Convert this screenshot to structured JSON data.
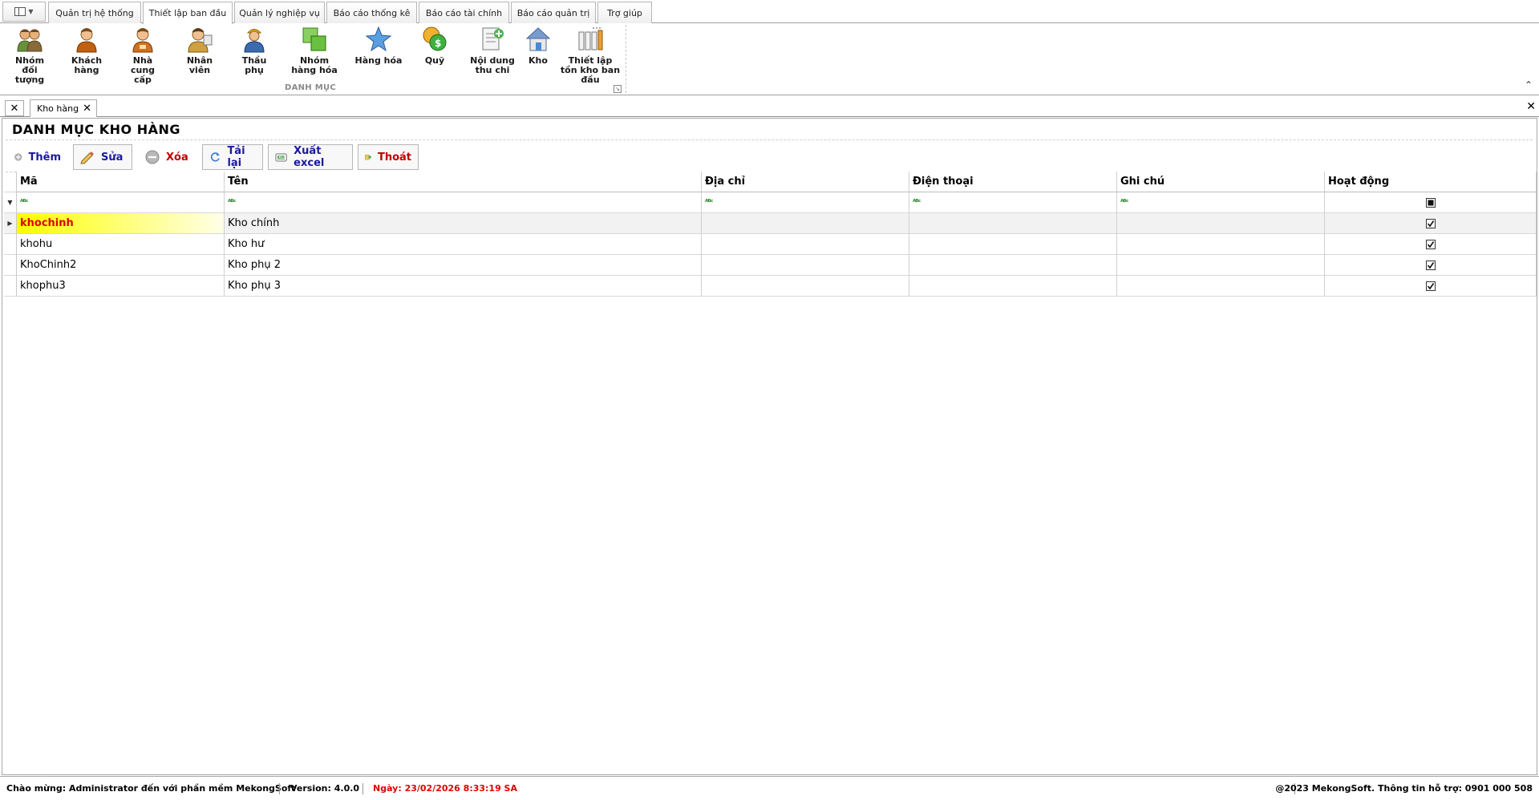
{
  "ribbon": {
    "tabs": [
      "Quản trị hệ thống",
      "Thiết lập ban đầu",
      "Quản lý nghiệp vụ",
      "Báo cáo thống kê",
      "Báo cáo tài chính",
      "Báo cáo quản trị",
      "Trợ giúp"
    ],
    "active_tab": "Thiết lập ban đầu",
    "buttons": [
      {
        "label": "Nhóm đối tượng",
        "icon": "users-group-icon"
      },
      {
        "label": "Khách hàng",
        "icon": "customer-icon"
      },
      {
        "label": "Nhà cung cấp",
        "icon": "supplier-icon"
      },
      {
        "label": "Nhân viên",
        "icon": "employee-icon"
      },
      {
        "label": "Thầu phụ",
        "icon": "worker-icon"
      },
      {
        "label": "Nhóm hàng hóa",
        "icon": "product-group-icon"
      },
      {
        "label": "Hàng hóa",
        "icon": "star-icon"
      },
      {
        "label": "Quỹ",
        "icon": "money-icon"
      },
      {
        "label": "Nội dung thu chi",
        "icon": "document-add-icon"
      },
      {
        "label": "Kho",
        "icon": "house-icon"
      },
      {
        "label": "Thiết lập tồn kho ban đầu",
        "icon": "inventory-columns-icon"
      }
    ],
    "group_label": "DANH MỤC"
  },
  "doc_tab": {
    "label": "Kho hàng"
  },
  "page": {
    "title": "DANH MỤC KHO HÀNG"
  },
  "toolbar": {
    "add": "Thêm",
    "edit": "Sửa",
    "delete": "Xóa",
    "reload": "Tải lại",
    "export": "Xuất excel",
    "exit": "Thoát"
  },
  "grid": {
    "columns": [
      "Mã",
      "Tên",
      "Địa chỉ",
      "Điện thoại",
      "Ghi chú",
      "Hoạt động"
    ],
    "rows": [
      {
        "code": "khochinh",
        "name": "Kho chính",
        "address": "",
        "phone": "",
        "note": "",
        "active": true
      },
      {
        "code": "khohu",
        "name": "Kho hư",
        "address": "",
        "phone": "",
        "note": "",
        "active": true
      },
      {
        "code": "KhoChinh2",
        "name": "Kho phụ 2",
        "address": "",
        "phone": "",
        "note": "",
        "active": true
      },
      {
        "code": "khophu3",
        "name": "Kho phụ 3",
        "address": "",
        "phone": "",
        "note": "",
        "active": true
      }
    ]
  },
  "status": {
    "welcome": "Chào mừng: Administrator đến với phần mềm MekongSoft",
    "version": "Version: 4.0.0",
    "date": "Ngày: 23/02/2026 8:33:19 SA",
    "support": "@2023 MekongSoft. Thông tin hỗ trợ: 0901 000 508"
  },
  "colors": {
    "add": "#1a1aa0",
    "edit": "#1a1aa0",
    "delete": "#c00000",
    "reload": "#1a1aa0",
    "export": "#1a1aa0",
    "exit": "#c00000",
    "selected_code": "#e00000",
    "status_date": "#e00000"
  }
}
